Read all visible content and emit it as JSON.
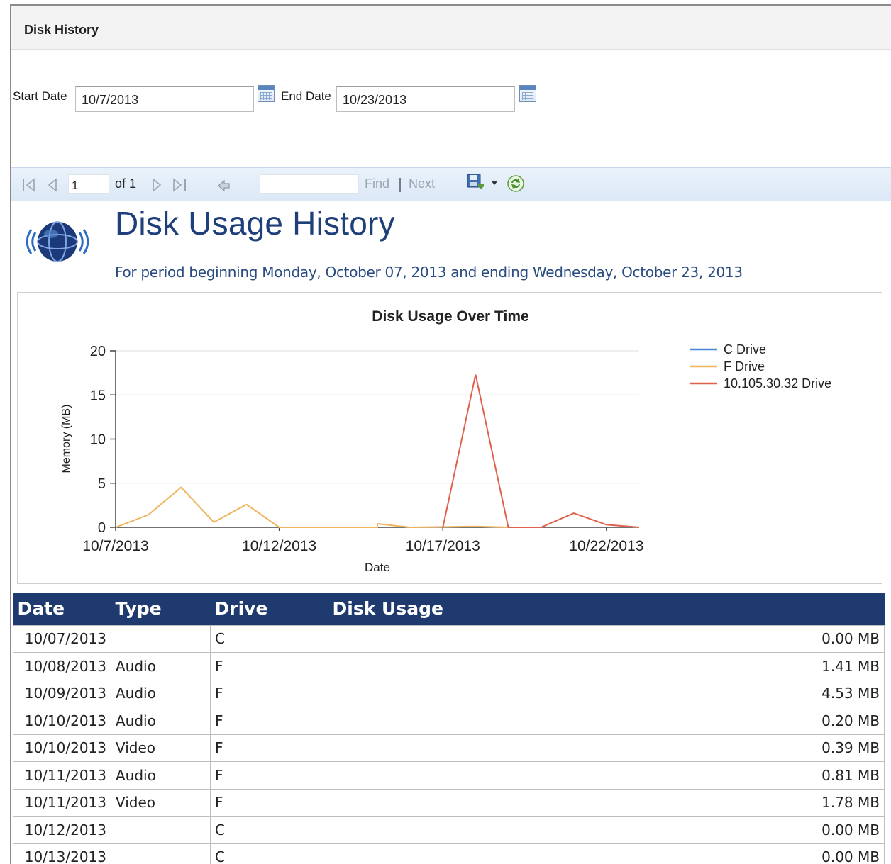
{
  "window": {
    "title": "Disk History"
  },
  "params": {
    "start_label": "Start Date",
    "start_value": "10/7/2013",
    "end_label": "End Date",
    "end_value": "10/23/2013"
  },
  "toolbar": {
    "page_value": "1",
    "of_label": "of 1",
    "find_label": "Find",
    "divider": "|",
    "next_label": "Next",
    "icons": [
      "first-page-icon",
      "prev-page-icon",
      "next-page-icon",
      "last-page-icon",
      "back-icon",
      "save-icon",
      "dropdown-arrow-icon",
      "refresh-icon"
    ]
  },
  "report": {
    "title": "Disk Usage History",
    "subtitle": "For period beginning Monday, October 07, 2013 and ending Wednesday, October 23, 2013"
  },
  "chart_data": {
    "type": "line",
    "title": "Disk Usage Over Time",
    "xlabel": "Date",
    "ylabel": "Memory (MB)",
    "ylim": [
      0,
      20
    ],
    "yticks": [
      0,
      5,
      10,
      15,
      20
    ],
    "xlim": [
      "10/7/2013",
      "10/23/2013"
    ],
    "xticks": [
      "10/7/2013",
      "10/12/2013",
      "10/17/2013",
      "10/22/2013"
    ],
    "grid": true,
    "legend_position": "right",
    "series": [
      {
        "name": "C Drive",
        "color": "#4a86d8",
        "points": []
      },
      {
        "name": "F Drive",
        "color": "#f0b45a",
        "points": [
          {
            "x": "10/7/2013",
            "y": 0.0
          },
          {
            "x": "10/8/2013",
            "y": 1.41
          },
          {
            "x": "10/9/2013",
            "y": 4.53
          },
          {
            "x": "10/10/2013",
            "y": 0.59
          },
          {
            "x": "10/11/2013",
            "y": 2.59
          },
          {
            "x": "10/12/2013",
            "y": 0.0
          },
          {
            "x": "10/15/2013",
            "y": 0.0
          },
          {
            "x": "10/15/2013",
            "y": 0.4
          },
          {
            "x": "10/16/2013",
            "y": 0.0
          },
          {
            "x": "10/18/2013",
            "y": 0.1
          },
          {
            "x": "10/19/2013",
            "y": 0.0
          }
        ]
      },
      {
        "name": "10.105.30.32 Drive",
        "color": "#e0604a",
        "points": [
          {
            "x": "10/17/2013",
            "y": 0.0
          },
          {
            "x": "10/18/2013",
            "y": 17.3
          },
          {
            "x": "10/19/2013",
            "y": 0.0
          },
          {
            "x": "10/20/2013",
            "y": 0.0
          },
          {
            "x": "10/21/2013",
            "y": 1.6
          },
          {
            "x": "10/22/2013",
            "y": 0.3
          },
          {
            "x": "10/23/2013",
            "y": 0.0
          }
        ]
      }
    ]
  },
  "table": {
    "headers": [
      "Date",
      "Type",
      "Drive",
      "Disk Usage"
    ],
    "rows": [
      [
        "10/07/2013",
        "",
        "C",
        "0.00 MB"
      ],
      [
        "10/08/2013",
        "Audio",
        "F",
        "1.41 MB"
      ],
      [
        "10/09/2013",
        "Audio",
        "F",
        "4.53 MB"
      ],
      [
        "10/10/2013",
        "Audio",
        "F",
        "0.20 MB"
      ],
      [
        "10/10/2013",
        "Video",
        "F",
        "0.39 MB"
      ],
      [
        "10/11/2013",
        "Audio",
        "F",
        "0.81 MB"
      ],
      [
        "10/11/2013",
        "Video",
        "F",
        "1.78 MB"
      ],
      [
        "10/12/2013",
        "",
        "C",
        "0.00 MB"
      ],
      [
        "10/13/2013",
        "",
        "C",
        "0.00 MB"
      ]
    ]
  }
}
